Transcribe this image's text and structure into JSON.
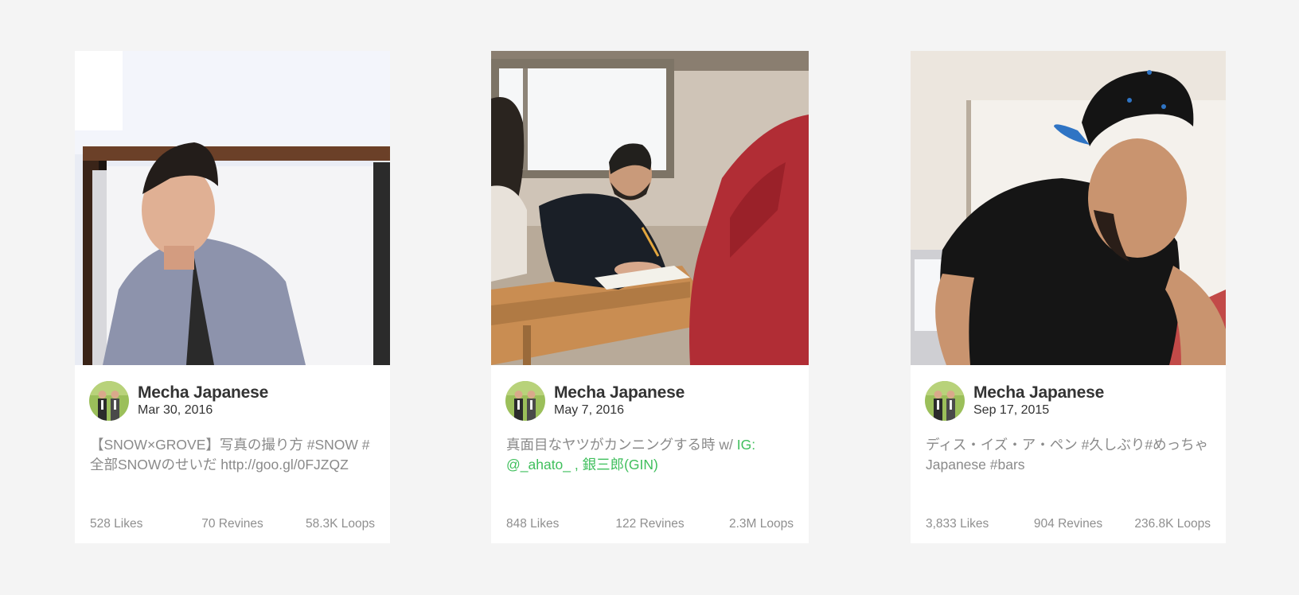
{
  "colors": {
    "background": "#f4f4f4",
    "card": "#ffffff",
    "name_text": "#333333",
    "caption_text": "#8a8a8a",
    "link_green": "#3fbf5c",
    "stats_text": "#8f8f8f"
  },
  "cards": [
    {
      "thumbnail_icon": "video-thumbnail-man-gray-blazer",
      "author": "Mecha Japanese",
      "date": "Mar 30, 2016",
      "caption": [
        {
          "text": "【SNOW×GROVE】写真の撮り方 #SNOW #全部SNOWのせいだ http://goo.gl/0FJZQZ",
          "link": false
        }
      ],
      "likes": "528 Likes",
      "revines": "70 Revines",
      "loops": "58.3K Loops"
    },
    {
      "thumbnail_icon": "video-thumbnail-classroom-test",
      "author": "Mecha Japanese",
      "date": "May 7, 2016",
      "caption": [
        {
          "text": "真面目なヤツがカンニングする時 w/ ",
          "link": false
        },
        {
          "text": "IG: @_ahato_ , 銀三郎(GIN)",
          "link": true
        }
      ],
      "likes": "848 Likes",
      "revines": "122 Revines",
      "loops": "2.3M Loops"
    },
    {
      "thumbnail_icon": "video-thumbnail-man-black-cap",
      "author": "Mecha Japanese",
      "date": "Sep 17, 2015",
      "caption": [
        {
          "text": "ディス・イズ・ア・ペン #久しぶり#めっちゃJapanese #bars",
          "link": false
        }
      ],
      "likes": "3,833 Likes",
      "revines": "904 Revines",
      "loops": "236.8K Loops"
    }
  ]
}
